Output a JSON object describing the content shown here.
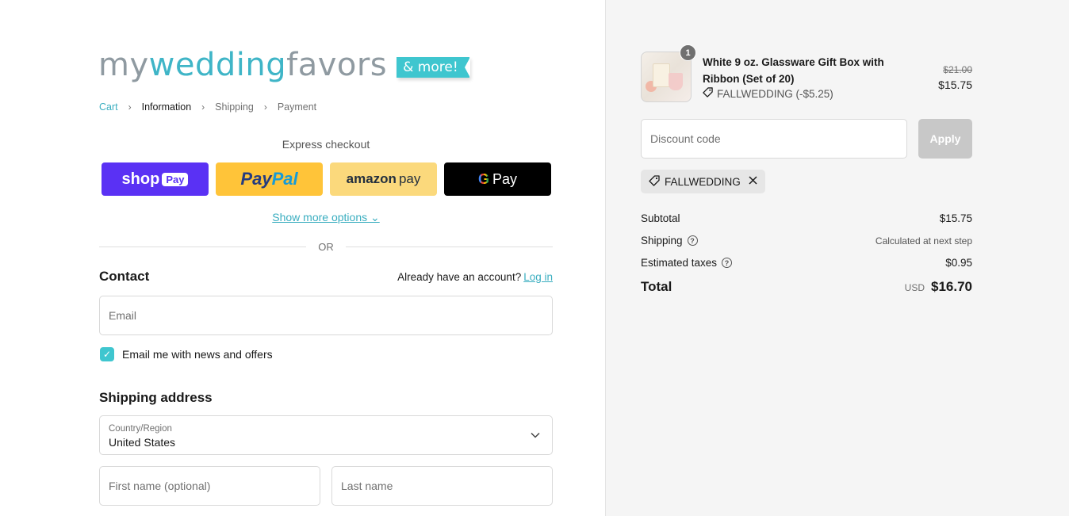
{
  "logo": {
    "my": "my",
    "wedding": "wedding",
    "favors": "favors",
    "badge": "& more!"
  },
  "breadcrumb": {
    "items": [
      {
        "label": "Cart"
      },
      {
        "label": "Information"
      },
      {
        "label": "Shipping"
      },
      {
        "label": "Payment"
      }
    ],
    "separator": "›"
  },
  "express": {
    "title": "Express checkout",
    "shop": {
      "text": "shop",
      "pill": "Pay"
    },
    "paypal": {
      "part1": "Pay",
      "part2": "Pal"
    },
    "amazon": {
      "part1": "amazon",
      "part2": "pay"
    },
    "gpay": {
      "g": "G",
      "text": "Pay"
    },
    "more_options": "Show more options ⌄",
    "or": "OR"
  },
  "contact": {
    "title": "Contact",
    "account_prompt": "Already have an account?",
    "login": "Log in",
    "email_placeholder": "Email",
    "news_label": "Email me with news and offers",
    "news_checked": true
  },
  "shipping": {
    "title": "Shipping address",
    "country_label": "Country/Region",
    "country_value": "United States",
    "first_name_placeholder": "First name (optional)",
    "last_name_placeholder": "Last name"
  },
  "summary": {
    "product": {
      "qty": "1",
      "title": "White 9 oz. Glassware Gift Box with Ribbon (Set of 20)",
      "discount": "FALLWEDDING (-$5.25)",
      "old_price": "$21.00",
      "price": "$15.75"
    },
    "discount_placeholder": "Discount code",
    "apply": "Apply",
    "applied_code": "FALLWEDDING",
    "subtotal_label": "Subtotal",
    "subtotal_value": "$15.75",
    "shipping_label": "Shipping",
    "shipping_value": "Calculated at next step",
    "taxes_label": "Estimated taxes",
    "taxes_value": "$0.95",
    "total_label": "Total",
    "currency": "USD",
    "total_value": "$16.70"
  },
  "colors": {
    "accent": "#3fc6cf",
    "link": "#3aaec0",
    "shop_pay": "#5a31f4",
    "paypal": "#ffc439",
    "amazon_pay": "#fbd97c",
    "summary_bg": "#f5f5f5"
  }
}
